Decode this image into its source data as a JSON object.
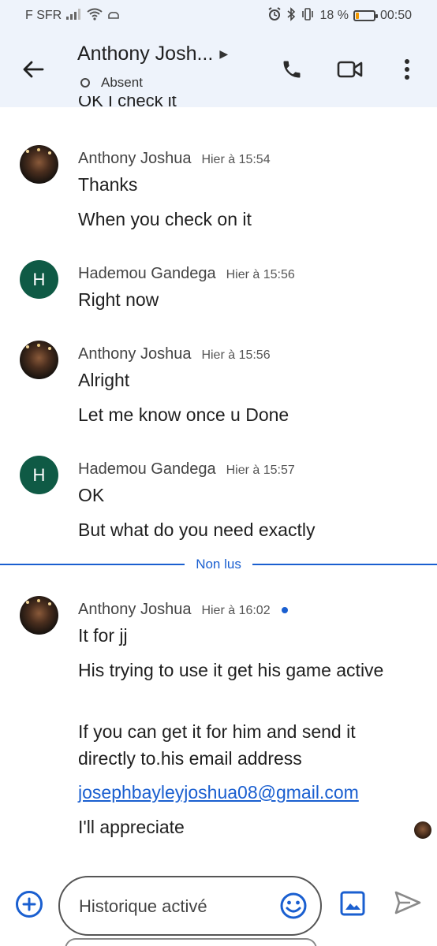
{
  "statusbar": {
    "carrier": "F SFR",
    "battery_percent_label": "18 %",
    "battery_level": 0.18,
    "time": "00:50"
  },
  "header": {
    "title": "Anthony Josh...",
    "status": "Absent"
  },
  "clipped_text": "OK I check it",
  "groups": [
    {
      "sender": "Anthony Joshua",
      "time": "Hier à 15:54",
      "avatar": "photo",
      "messages": [
        "Thanks",
        "When you check on it"
      ]
    },
    {
      "sender": "Hademou Gandega",
      "time": "Hier à 15:56",
      "avatar": "letter",
      "avatar_letter": "H",
      "messages": [
        "Right now"
      ]
    },
    {
      "sender": "Anthony Joshua",
      "time": "Hier à 15:56",
      "avatar": "photo",
      "messages": [
        "Alright",
        "Let me know once u Done"
      ]
    },
    {
      "sender": "Hademou Gandega",
      "time": "Hier à 15:57",
      "avatar": "letter",
      "avatar_letter": "H",
      "messages": [
        "OK",
        "But what do you need exactly"
      ]
    },
    {
      "sender": "Anthony Joshua",
      "time": "Hier à 16:02",
      "avatar": "photo",
      "messages": [
        "It for jj",
        "His trying to use it get his game active",
        "If you can get it for him and send it directly to.his email address",
        "josephbayleyjoshua08@gmail.com",
        "I'll appreciate"
      ]
    }
  ],
  "divider_label": "Non lus",
  "compose": {
    "placeholder": "Historique activé"
  },
  "colors": {
    "accent": "#1a5fd0",
    "header_bg": "#eef3fb",
    "letter_avatar": "#0f5a45"
  }
}
